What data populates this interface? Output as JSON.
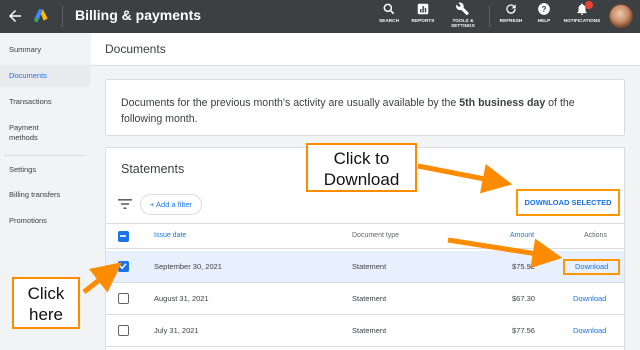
{
  "topbar": {
    "title": "Billing & payments",
    "buttons": [
      {
        "label": "SEARCH",
        "icon": "search-icon"
      },
      {
        "label": "REPORTS",
        "icon": "reports-icon"
      },
      {
        "label": "TOOLS & SETTINGS",
        "icon": "wrench-icon"
      },
      {
        "label": "REFRESH",
        "icon": "refresh-icon"
      },
      {
        "label": "HELP",
        "icon": "help-icon"
      },
      {
        "label": "NOTIFICATIONS",
        "icon": "bell-icon"
      }
    ],
    "notification_badge": "1",
    "colors": {
      "bar": "#3c4043",
      "badge": "#ea4335"
    }
  },
  "sidebar": {
    "items": [
      {
        "label": "Summary"
      },
      {
        "label": "Documents"
      },
      {
        "label": "Transactions"
      },
      {
        "label": "Payment methods"
      },
      {
        "label": "Settings"
      },
      {
        "label": "Billing transfers"
      },
      {
        "label": "Promotions"
      }
    ],
    "active": "Documents"
  },
  "main": {
    "heading": "Documents",
    "info_prefix": "Documents for the previous month's activity are usually available by the ",
    "info_bold": "5th business day",
    "info_suffix": " of the following month."
  },
  "statements": {
    "title": "Statements",
    "add_filter": "+ Add a filter",
    "download_selected": "DOWNLOAD SELECTED",
    "columns": {
      "issue_date": "Issue date",
      "document_type": "Document type",
      "amount": "Amount",
      "actions": "Actions"
    },
    "rows": [
      {
        "date": "September 30, 2021",
        "type": "Statement",
        "amount": "$75.92",
        "action": "Download",
        "checked": true
      },
      {
        "date": "August 31, 2021",
        "type": "Statement",
        "amount": "$67.30",
        "action": "Download",
        "checked": false
      },
      {
        "date": "July 31, 2021",
        "type": "Statement",
        "amount": "$77.56",
        "action": "Download",
        "checked": false
      }
    ]
  },
  "annotations": {
    "click_to_download": "Click to Download",
    "click_to_download_l1": "Click to",
    "click_to_download_l2": "Download",
    "click_here_l1": "Click",
    "click_here_l2": "here",
    "color": "#ff8c00"
  },
  "accent": "#1a73e8"
}
